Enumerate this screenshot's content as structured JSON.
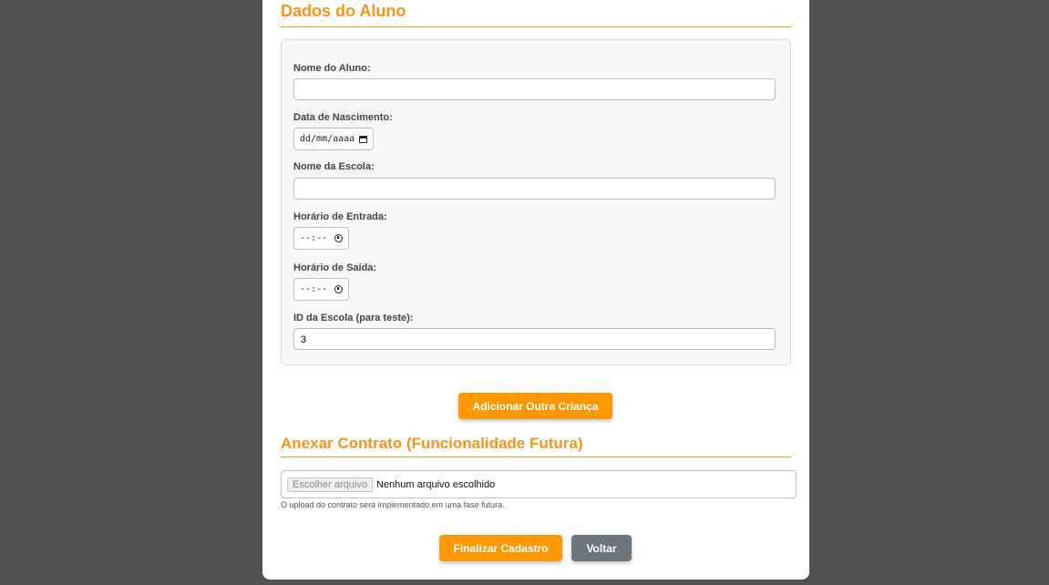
{
  "student_section": {
    "title": "Dados do Aluno",
    "fields": {
      "name_label": "Nome do Aluno:",
      "name_value": "",
      "birth_label": "Data de Nascimento:",
      "birth_placeholder": "dd/mm/aaaa",
      "school_label": "Nome da Escola:",
      "school_value": "",
      "entry_label": "Horário de Entrada:",
      "entry_placeholder": "--:--",
      "exit_label": "Horário de Saída:",
      "exit_placeholder": "--:--",
      "school_id_label": "ID da Escola (para teste):",
      "school_id_value": "3"
    }
  },
  "add_child_button": "Adicionar Outra Criança",
  "contract_section": {
    "title": "Anexar Contrato (Funcionalidade Futura)",
    "file_button": "Escolher arquivo",
    "file_status": "Nenhum arquivo escolhido",
    "hint": "O upload do contrato será implementado em uma fase futura."
  },
  "actions": {
    "finish_label": "Finalizar Cadastro",
    "back_label": "Voltar"
  },
  "colors": {
    "accent": "#f7941d",
    "button_orange": "#ff9800",
    "button_gray": "#6c757d",
    "backdrop": "#515151"
  }
}
